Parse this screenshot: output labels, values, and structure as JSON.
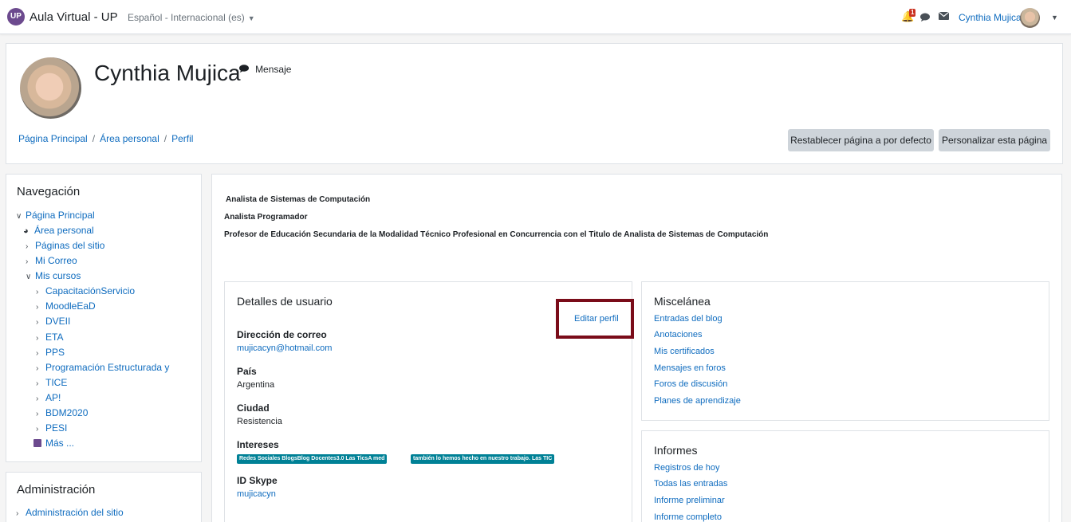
{
  "navbar": {
    "logo_text": "UP",
    "site_name": "Aula Virtual - UP",
    "language": "Español - Internacional (es)",
    "notification_count": "1",
    "user_name": "Cynthia Mujica"
  },
  "header": {
    "name": "Cynthia Mujica",
    "message_label": "Mensaje",
    "breadcrumb": [
      "Página Principal",
      "Área personal",
      "Perfil"
    ],
    "reset_button": "Restablecer página a por defecto",
    "customize_button": "Personalizar esta página"
  },
  "navigation": {
    "title": "Navegación",
    "home": "Página Principal",
    "dashboard": "Área personal",
    "site_pages": "Páginas del sitio",
    "mail": "Mi Correo",
    "my_courses": "Mis cursos",
    "courses": [
      "CapacitaciónServicio",
      "MoodleEaD",
      "DVEII",
      "ETA",
      "PPS",
      "Programación Estructurada y",
      "TICE",
      "AP!",
      "BDM2020",
      "PESI"
    ],
    "more": "Más ..."
  },
  "administration": {
    "title": "Administración",
    "site_admin": "Administración del sitio"
  },
  "description": [
    "Analista de Sistemas de Computación",
    "Analista Programador",
    "Profesor de Educación Secundaria de la Modalidad Técnico Profesional en Concurrencia con el Titulo de Analista de Sistemas de Computación"
  ],
  "user_details": {
    "title": "Detalles de usuario",
    "edit_profile": "Editar perfil",
    "email_label": "Dirección de correo",
    "email": "mujicacyn@hotmail.com",
    "country_label": "País",
    "country": "Argentina",
    "city_label": "Ciudad",
    "city": "Resistencia",
    "interests_label": "Intereses",
    "interests": [
      "Redes Sociales BlogsBlog Docentes3.0 Las TicsA med",
      "también lo hemos hecho en nuestro trabajo. Las TIC"
    ],
    "skype_label": "ID Skype",
    "skype": "mujicacyn"
  },
  "misc": {
    "title": "Miscelánea",
    "links": [
      "Entradas del blog",
      "Anotaciones",
      "Mis certificados",
      "Mensajes en foros",
      "Foros de discusión",
      "Planes de aprendizaje"
    ]
  },
  "reports": {
    "title": "Informes",
    "links": [
      "Registros de hoy",
      "Todas las entradas",
      "Informe preliminar",
      "Informe completo"
    ]
  },
  "colors": {
    "link": "#0f6cbf",
    "highlight_border": "#7a0c19",
    "tag": "#008196",
    "badge": "#ca3120",
    "brand": "#6c4a8e"
  }
}
